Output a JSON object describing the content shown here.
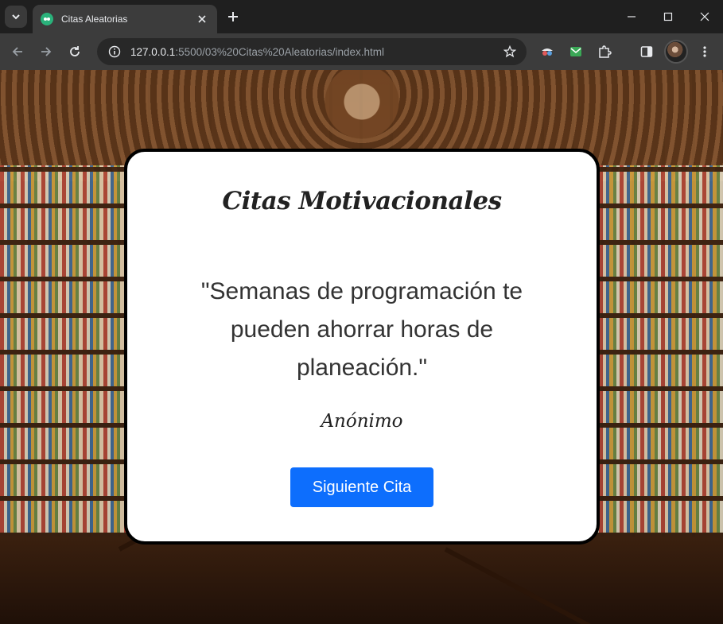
{
  "browser": {
    "tab": {
      "title": "Citas Aleatorias",
      "favicon": "chat-bubble-icon"
    },
    "url": {
      "host": "127.0.0.1",
      "path": ":5500/03%20Citas%20Aleatorias/index.html"
    },
    "colors": {
      "tabbar": "#1f1f1f",
      "toolbar": "#3c3c3c",
      "omnibox": "#282828"
    }
  },
  "page": {
    "title": "Citas Motivacionales",
    "quote": "\"Semanas de programación te pueden ahorrar horas de planeación.\"",
    "author": "Anónimo",
    "next_button": "Siguiente Cita",
    "colors": {
      "button": "#0d6efd",
      "card": "#ffffff",
      "card_border": "#000000"
    }
  }
}
